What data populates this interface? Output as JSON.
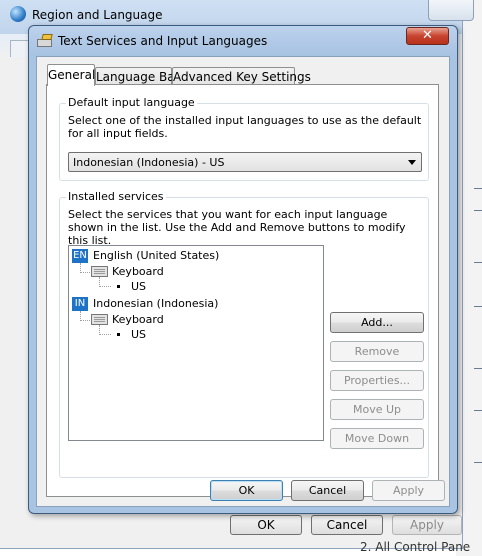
{
  "outer_window": {
    "title": "Region and Language",
    "buttons": {
      "ok": "OK",
      "cancel": "Cancel",
      "apply": "Apply"
    },
    "bottom_text": "2.   All Control Pane"
  },
  "dialog": {
    "title": "Text Services and Input Languages",
    "close_glyph": "✕",
    "tabs": [
      {
        "label": "General",
        "active": true
      },
      {
        "label": "Language Bar",
        "active": false
      },
      {
        "label": "Advanced Key Settings",
        "active": false
      }
    ],
    "default_input": {
      "group_label": "Default input language",
      "description": "Select one of the installed input languages to use as the default for all input fields.",
      "selected": "Indonesian (Indonesia) - US"
    },
    "installed_services": {
      "group_label": "Installed services",
      "description": "Select the services that you want for each input language shown in the list. Use the Add and Remove buttons to modify this list.",
      "languages": [
        {
          "badge": "EN",
          "name": "English (United States)",
          "category": "Keyboard",
          "service": "US"
        },
        {
          "badge": "IN",
          "name": "Indonesian (Indonesia)",
          "category": "Keyboard",
          "service": "US"
        }
      ],
      "buttons": {
        "add": "Add...",
        "remove": "Remove",
        "properties": "Properties...",
        "move_up": "Move Up",
        "move_down": "Move Down"
      }
    },
    "footer": {
      "ok": "OK",
      "cancel": "Cancel",
      "apply": "Apply"
    }
  },
  "colors": {
    "accent": "#1e73c7",
    "close_button": "#c7432f"
  }
}
